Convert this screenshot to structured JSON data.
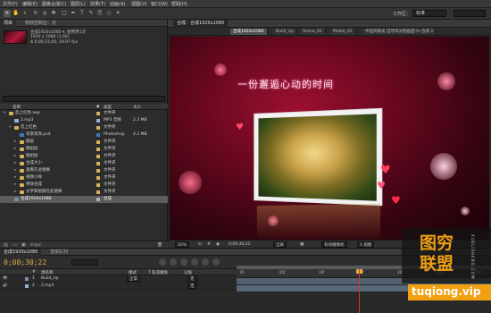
{
  "menu": [
    "文件(F)",
    "编辑(E)",
    "图像合成(C)",
    "图层(L)",
    "效果(T)",
    "动画(A)",
    "视图(V)",
    "窗口(W)",
    "帮助(H)"
  ],
  "toolbar": {
    "workspace_label": "工作区：",
    "workspace_value": "标准"
  },
  "project": {
    "tabs": [
      "项目",
      "特效控制台：无"
    ],
    "selected_name": "合成1920x1080 ▾, 使用用1次",
    "info": [
      "1920 x 1080 (1.00)",
      "Δ 0;00;31;00, 29.97 fps"
    ],
    "columns": {
      "name": "名称",
      "label": "◆",
      "type": "类型",
      "size": "大小"
    },
    "rows": [
      {
        "indent": 0,
        "arrow": "▾",
        "icon": "folder",
        "name": "恋上红色.aep",
        "type": "文件夹",
        "size": "",
        "label": "#d6b35a"
      },
      {
        "indent": 1,
        "arrow": "",
        "icon": "audio",
        "name": "2.mp3",
        "type": "MP3 音频",
        "size": "2.3 MB",
        "label": "#8fb0d8"
      },
      {
        "indent": 1,
        "arrow": "▾",
        "icon": "folder",
        "name": "恋上红色",
        "type": "文件夹",
        "size": "",
        "label": "#d6b35a"
      },
      {
        "indent": 2,
        "arrow": "",
        "icon": "psd",
        "name": "背景装饰.psd",
        "type": "Photoshop",
        "size": "4.2 MB",
        "label": "#3a7ab8"
      },
      {
        "indent": 2,
        "arrow": "▸",
        "icon": "folder",
        "name": "图层",
        "type": "文件夹",
        "size": "",
        "label": "#d6b35a"
      },
      {
        "indent": 2,
        "arrow": "▸",
        "icon": "folder",
        "name": "图组层",
        "type": "文件夹",
        "size": "",
        "label": "#d6b35a"
      },
      {
        "indent": 2,
        "arrow": "▸",
        "icon": "folder",
        "name": "图组层",
        "type": "文件夹",
        "size": "",
        "label": "#d6b35a"
      },
      {
        "indent": 2,
        "arrow": "▸",
        "icon": "folder",
        "name": "合成大小",
        "type": "文件夹",
        "size": "",
        "label": "#d6b35a"
      },
      {
        "indent": 2,
        "arrow": "▸",
        "icon": "folder",
        "name": "查看在此替换",
        "type": "文件夹",
        "size": "",
        "label": "#d6b35a"
      },
      {
        "indent": 2,
        "arrow": "▸",
        "icon": "folder",
        "name": "视频小样",
        "type": "文件夹",
        "size": "",
        "label": "#d6b35a"
      },
      {
        "indent": 2,
        "arrow": "▸",
        "icon": "folder",
        "name": "特效合成",
        "type": "文件夹",
        "size": "",
        "label": "#d6b35a"
      },
      {
        "indent": 2,
        "arrow": "▸",
        "icon": "folder",
        "name": "文字和视频在此替换",
        "type": "文件夹",
        "size": "",
        "label": "#d6b35a"
      },
      {
        "indent": 1,
        "arrow": "",
        "icon": "comp",
        "name": "合成1920x1080",
        "type": "合成",
        "size": "",
        "label": "#b0b0b0",
        "selected": true
      }
    ],
    "footer": "8 bpc"
  },
  "composition": {
    "tab": "合成：合成1920x1080",
    "crumbs": [
      "合成1920x1080",
      "Build_Up",
      "Scene_02",
      "Media_02",
      "中国风联式-自然风光图画面-fv-合成 2"
    ],
    "caption": "一份邂逅心动的时间",
    "footer": {
      "zoom": "50%",
      "timecode": "0;00;30;22",
      "resolution": "全屏",
      "camera": "有效摄像机",
      "views": "1 视图"
    }
  },
  "timeline": {
    "tabs": [
      "合成1920x1080",
      "渲染队列"
    ],
    "timecode": "0;00;30;22",
    "columns": {
      "num": "#",
      "name": "源名称",
      "mode": "模式",
      "trkmat": "T 轨道蒙板",
      "parent": "父级"
    },
    "layers": [
      {
        "num": "1",
        "name": "Build_Up",
        "mode": "正常",
        "parent": "无",
        "label": "#7b8fa8"
      },
      {
        "num": "2",
        "name": "2.mp3",
        "mode": "",
        "parent": "无",
        "label": "#8fb0d8"
      }
    ],
    "ruler": [
      "0f",
      "05f",
      "10f",
      "15f",
      "20f",
      "25f",
      "30f"
    ]
  },
  "watermark": {
    "line1": "图穷",
    "line2": "联盟",
    "side": "XUELISHENG.COM",
    "url": "tuqiong.vip"
  }
}
